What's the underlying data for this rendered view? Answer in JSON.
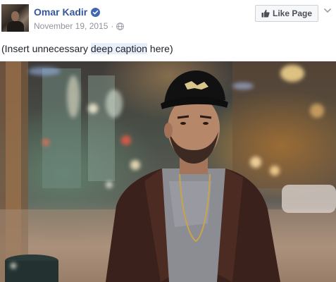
{
  "post": {
    "page_name": "Omar Kadir",
    "verified_icon": "verified-badge-icon",
    "date": "November 19, 2015",
    "separator": "·",
    "privacy_icon": "globe-icon",
    "like_button_label": "Like Page",
    "like_button_icon": "thumbs-up-icon",
    "options_icon": "chevron-down-icon"
  },
  "caption": {
    "before": "(Insert unnecessary ",
    "highlight": "deep caption",
    "after": " here)"
  },
  "colors": {
    "link_blue": "#365899",
    "verified_blue": "#4267b2",
    "meta_gray": "#90949c",
    "highlight_bg": "#e8eefa",
    "button_bg": "#f6f7f9",
    "button_border": "#ced0d4"
  }
}
